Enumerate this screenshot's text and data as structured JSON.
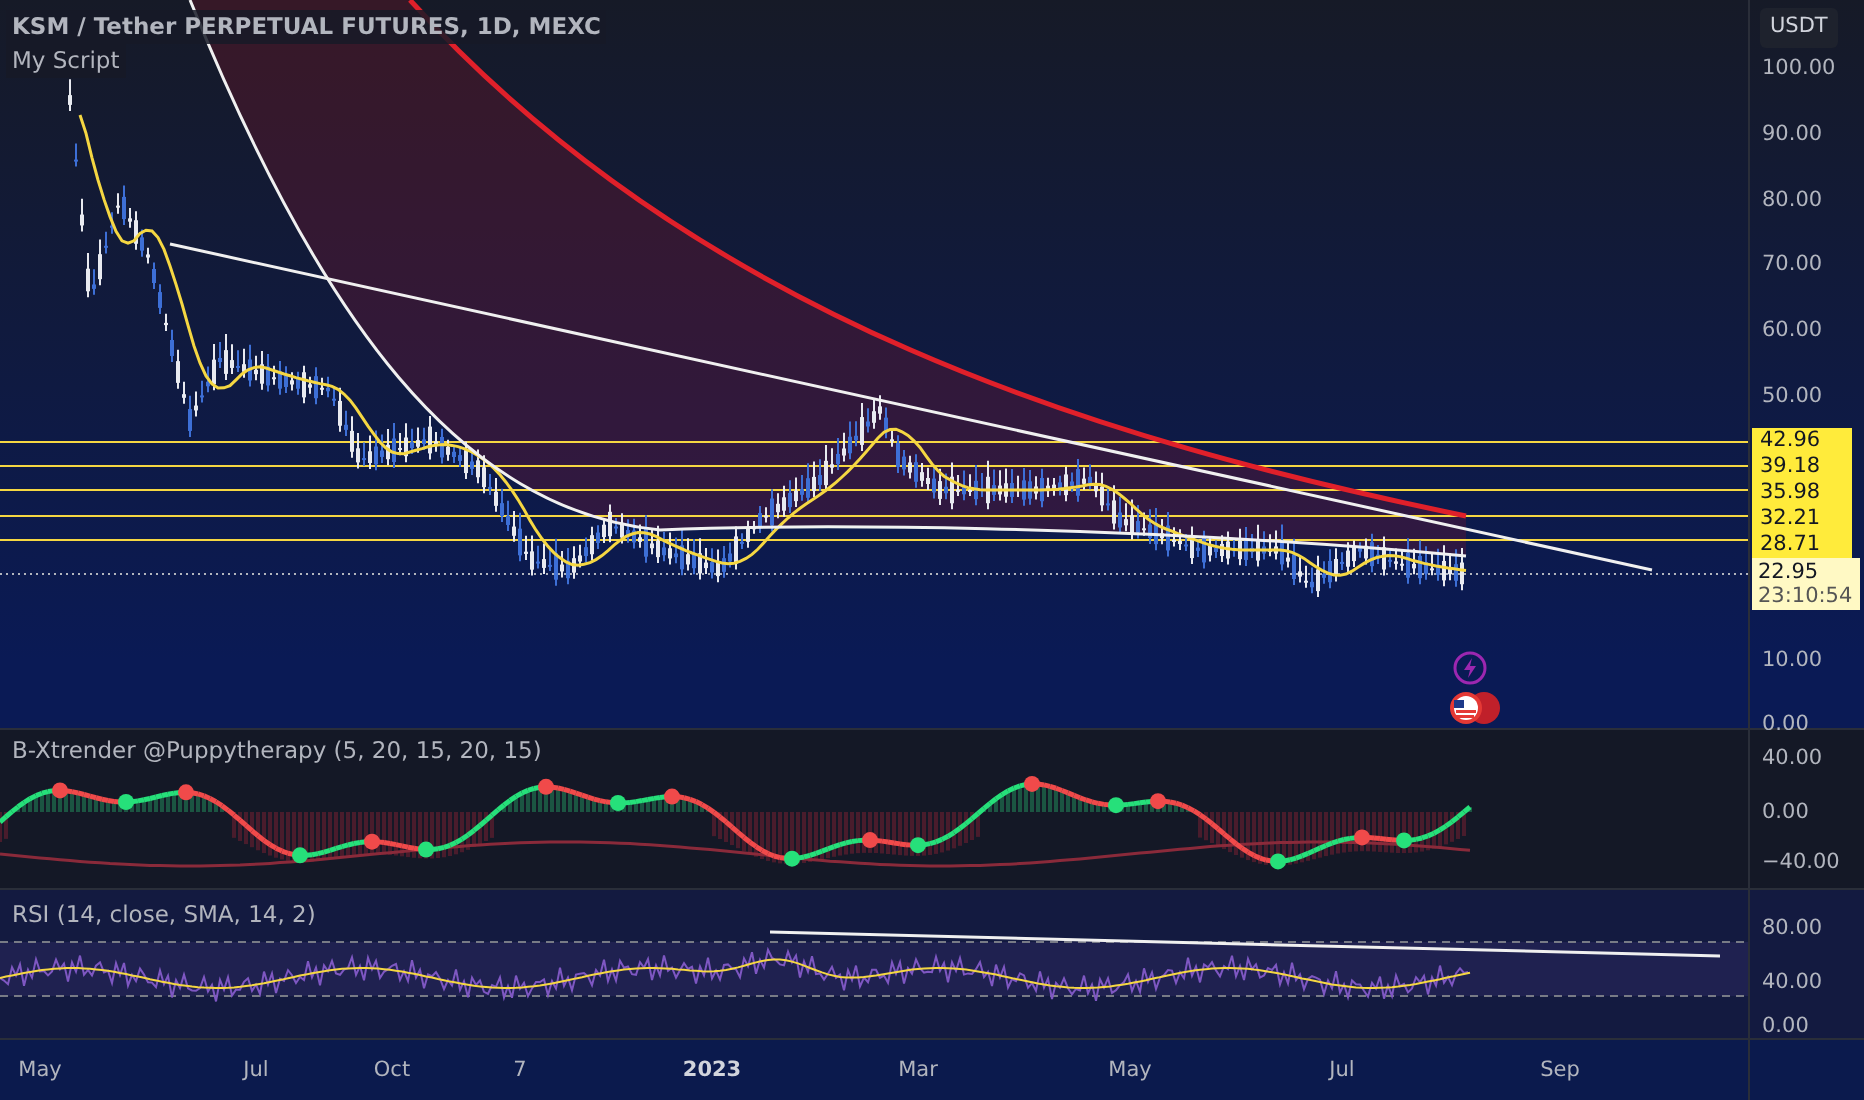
{
  "header": {
    "symbol": "KSM / Tether PERPETUAL FUTURES, 1D, MEXC",
    "script": "My Script"
  },
  "currency": "USDT",
  "price_axis": [
    "100.00",
    "90.00",
    "80.00",
    "70.00",
    "60.00",
    "50.00",
    "10.00",
    "0.00"
  ],
  "price_levels": [
    "42.96",
    "39.18",
    "35.98",
    "32.21",
    "28.71"
  ],
  "last_price": {
    "value": "22.95",
    "countdown": "23:10:54"
  },
  "xtrender": {
    "title": "B-Xtrender @Puppytherapy (5, 20, 15, 20, 15)",
    "axis": [
      "40.00",
      "0.00",
      "−40.00"
    ]
  },
  "rsi": {
    "title": "RSI (14, close, SMA, 14, 2)",
    "axis": [
      "80.00",
      "40.00",
      "0.00"
    ]
  },
  "time_axis": [
    {
      "label": "May",
      "bold": false
    },
    {
      "label": "Jul",
      "bold": false
    },
    {
      "label": "Oct",
      "bold": false
    },
    {
      "label": "7",
      "bold": false
    },
    {
      "label": "2023",
      "bold": true
    },
    {
      "label": "Mar",
      "bold": false
    },
    {
      "label": "May",
      "bold": false
    },
    {
      "label": "Jul",
      "bold": false
    },
    {
      "label": "Sep",
      "bold": false
    }
  ]
}
